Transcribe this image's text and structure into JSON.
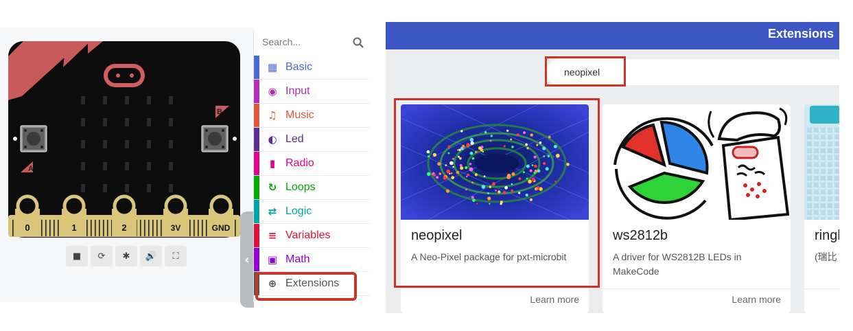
{
  "simulator": {
    "pins": [
      "0",
      "1",
      "2",
      "3V",
      "GND"
    ],
    "button_a": "A",
    "button_b": "B",
    "toolbar": [
      {
        "icon": "stop-icon",
        "glyph": "■"
      },
      {
        "icon": "restart-icon",
        "glyph": "⟳"
      },
      {
        "icon": "debug-icon",
        "glyph": "✱"
      },
      {
        "icon": "sound-icon",
        "glyph": "🔊"
      },
      {
        "icon": "fullscreen-icon",
        "glyph": "⛶"
      }
    ],
    "collapse_glyph": "‹"
  },
  "toolbox": {
    "search_placeholder": "Search...",
    "categories": [
      {
        "label": "Basic",
        "color": "#4c68d7",
        "icon": "grid-icon",
        "glyph": "▦"
      },
      {
        "label": "Input",
        "color": "#b12db1",
        "icon": "target-icon",
        "glyph": "◉"
      },
      {
        "label": "Music",
        "color": "#e0593f",
        "icon": "headphones-icon",
        "glyph": "♫"
      },
      {
        "label": "Led",
        "color": "#5c2d91",
        "icon": "toggle-icon",
        "glyph": "◐"
      },
      {
        "label": "Radio",
        "color": "#e3008c",
        "icon": "signal-icon",
        "glyph": "▮"
      },
      {
        "label": "Loops",
        "color": "#00aa00",
        "icon": "loop-icon",
        "glyph": "↻"
      },
      {
        "label": "Logic",
        "color": "#00a4a6",
        "icon": "shuffle-icon",
        "glyph": "⇄"
      },
      {
        "label": "Variables",
        "color": "#dc143c",
        "icon": "list-icon",
        "glyph": "≡"
      },
      {
        "label": "Math",
        "color": "#9400d3",
        "icon": "calculator-icon",
        "glyph": "▣"
      },
      {
        "label": "Extensions",
        "color": "#555555",
        "icon": "plus-circle-icon",
        "glyph": "⊕"
      }
    ]
  },
  "extensions": {
    "title": "Extensions",
    "search_value": "neopixel",
    "cards": [
      {
        "name": "neopixel",
        "description": "A Neo-Pixel package for pxt-microbit",
        "learn": "Learn more"
      },
      {
        "name": "ws2812b",
        "description": "A driver for WS2812B LEDs in MakeCode",
        "learn": "Learn more"
      },
      {
        "name": "ringl",
        "description": "(瑞比 moto",
        "learn": ""
      }
    ]
  }
}
